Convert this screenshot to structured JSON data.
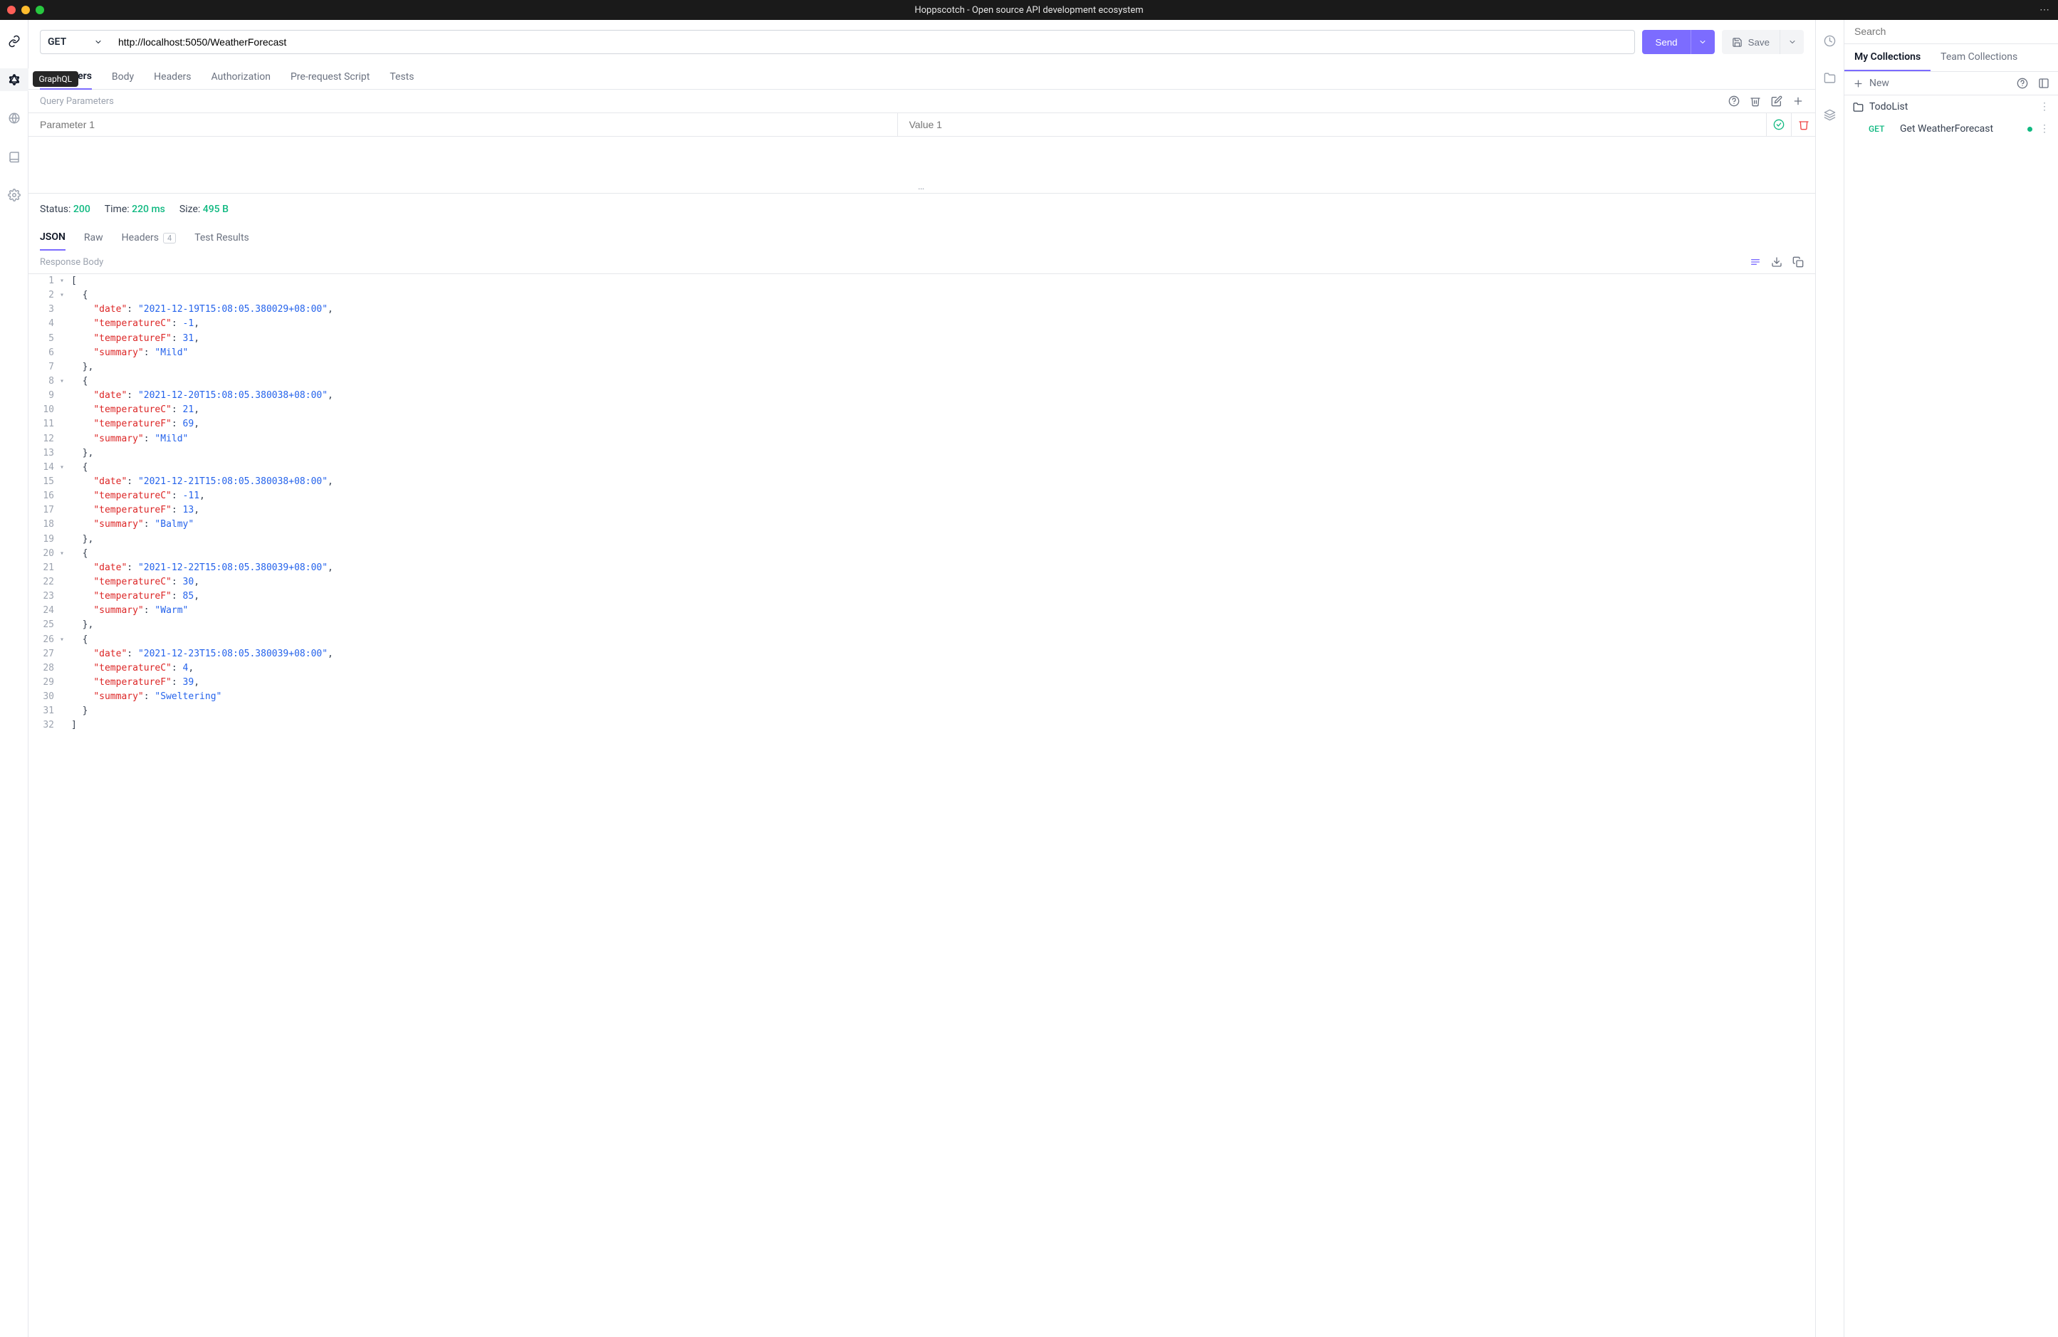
{
  "window": {
    "title": "Hoppscotch - Open source API development ecosystem"
  },
  "left_nav": {
    "items": [
      "rest",
      "graphql",
      "realtime",
      "docs",
      "settings"
    ],
    "tooltip": "GraphQL"
  },
  "request": {
    "method": "GET",
    "url": "http://localhost:5050/WeatherForecast",
    "send_label": "Send",
    "save_label": "Save"
  },
  "req_tabs": [
    "Parameters",
    "Body",
    "Headers",
    "Authorization",
    "Pre-request Script",
    "Tests"
  ],
  "query_params": {
    "label": "Query Parameters",
    "param_placeholder": "Parameter 1",
    "value_placeholder": "Value 1"
  },
  "response": {
    "status_label": "Status:",
    "status_value": "200",
    "time_label": "Time:",
    "time_value": "220 ms",
    "size_label": "Size:",
    "size_value": "495 B"
  },
  "resp_tabs": {
    "json": "JSON",
    "raw": "Raw",
    "headers": "Headers",
    "headers_count": "4",
    "test_results": "Test Results",
    "body_label": "Response Body"
  },
  "json_body": [
    {
      "date": "2021-12-19T15:08:05.380029+08:00",
      "temperatureC": -1,
      "temperatureF": 31,
      "summary": "Mild"
    },
    {
      "date": "2021-12-20T15:08:05.380038+08:00",
      "temperatureC": 21,
      "temperatureF": 69,
      "summary": "Mild"
    },
    {
      "date": "2021-12-21T15:08:05.380038+08:00",
      "temperatureC": -11,
      "temperatureF": 13,
      "summary": "Balmy"
    },
    {
      "date": "2021-12-22T15:08:05.380039+08:00",
      "temperatureC": 30,
      "temperatureF": 85,
      "summary": "Warm"
    },
    {
      "date": "2021-12-23T15:08:05.380039+08:00",
      "temperatureC": 4,
      "temperatureF": 39,
      "summary": "Sweltering"
    }
  ],
  "right_panel": {
    "search_placeholder": "Search",
    "tab_my": "My Collections",
    "tab_team": "Team Collections",
    "new_label": "New",
    "folder_name": "TodoList",
    "request_method": "GET",
    "request_name": "Get WeatherForecast"
  }
}
